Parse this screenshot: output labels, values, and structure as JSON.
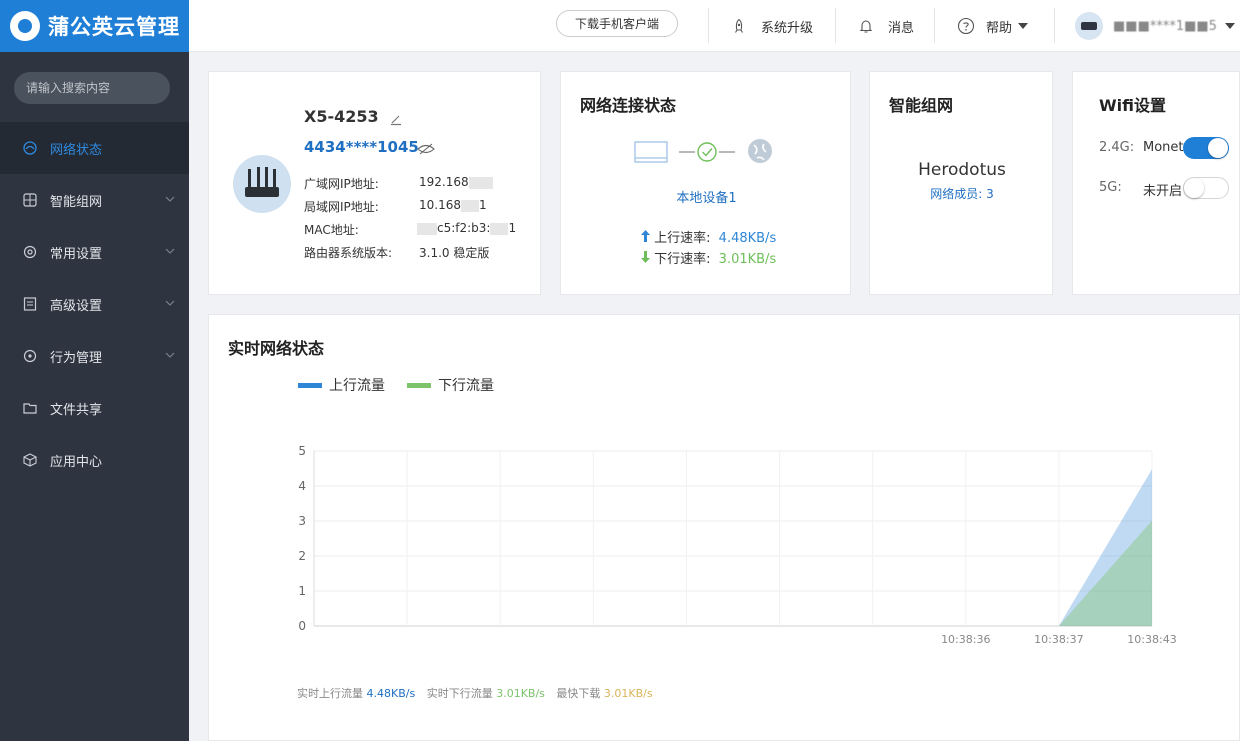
{
  "app": {
    "title": "蒲公英云管理"
  },
  "sidebar": {
    "search_placeholder": "请输入搜索内容",
    "items": [
      {
        "label": "网络状态",
        "icon": "network-icon"
      },
      {
        "label": "智能组网",
        "icon": "mesh-icon"
      },
      {
        "label": "常用设置",
        "icon": "settings-icon"
      },
      {
        "label": "高级设置",
        "icon": "document-icon"
      },
      {
        "label": "行为管理",
        "icon": "behavior-icon"
      },
      {
        "label": "文件共享",
        "icon": "folder-icon"
      },
      {
        "label": "应用中心",
        "icon": "cube-icon"
      }
    ]
  },
  "header": {
    "download_label": "下载手机客户端",
    "upgrade_label": "系统升级",
    "messages_label": "消息",
    "help_label": "帮助",
    "username": "■■■****1■■5"
  },
  "device_card": {
    "name": "X5-4253",
    "sn": "4434****1045",
    "rows": [
      {
        "label": "广域网IP地址:",
        "value": "192.168"
      },
      {
        "label": "局域网IP地址:",
        "value": "10.168"
      },
      {
        "label": "MAC地址:",
        "value": "c5:f2:b3:"
      },
      {
        "label": "路由器系统版本:",
        "value": "3.1.0 稳定版"
      }
    ],
    "lan_suffix": "1",
    "mac_suffix": "1"
  },
  "connection_card": {
    "title": "网络连接状态",
    "device_link": "本地设备1",
    "upload_label": "上行速率:",
    "upload_value": "4.48KB/s",
    "download_label": "下行速率:",
    "download_value": "3.01KB/s"
  },
  "mesh_card": {
    "title": "智能组网",
    "network_name": "Herodotus",
    "members_label": "网络成员:",
    "members_count": "3"
  },
  "wifi_card": {
    "title": "Wifi设置",
    "band_24_label": "2.4G:",
    "band_24_ssid": "Monet",
    "band_24_on": true,
    "band_5_label": "5G:",
    "band_5_ssid": "未开启",
    "band_5_on": false
  },
  "realtime": {
    "title": "实时网络状态",
    "legend_up": "上行流量",
    "legend_down": "下行流量",
    "stats_up_label": "实时上行流量",
    "stats_up_value": "4.48KB/s",
    "stats_down_label": "实时下行流量",
    "stats_down_value": "3.01KB/s",
    "stats_max_label": "最快下载",
    "stats_max_value": "3.01KB/s"
  },
  "colors": {
    "accent": "#1f7fd6",
    "sidebar": "#2e3540",
    "up": "#2f86d6",
    "down": "#7cc36b",
    "max": "#d8b45a"
  },
  "chart_data": {
    "type": "area",
    "x": [
      "",
      "",
      "",
      "",
      "",
      "",
      "",
      "10:38:36",
      "10:38:37",
      "10:38:43"
    ],
    "series": [
      {
        "name": "上行流量",
        "values": [
          0,
          0,
          0,
          0,
          0,
          0,
          0,
          0,
          0,
          4.48
        ]
      },
      {
        "name": "下行流量",
        "values": [
          0,
          0,
          0,
          0,
          0,
          0,
          0,
          0,
          0,
          3.01
        ]
      }
    ],
    "ylim": [
      0,
      5
    ],
    "yticks": [
      0,
      1,
      2,
      3,
      4,
      5
    ],
    "grid": true,
    "legend": "top-left"
  }
}
